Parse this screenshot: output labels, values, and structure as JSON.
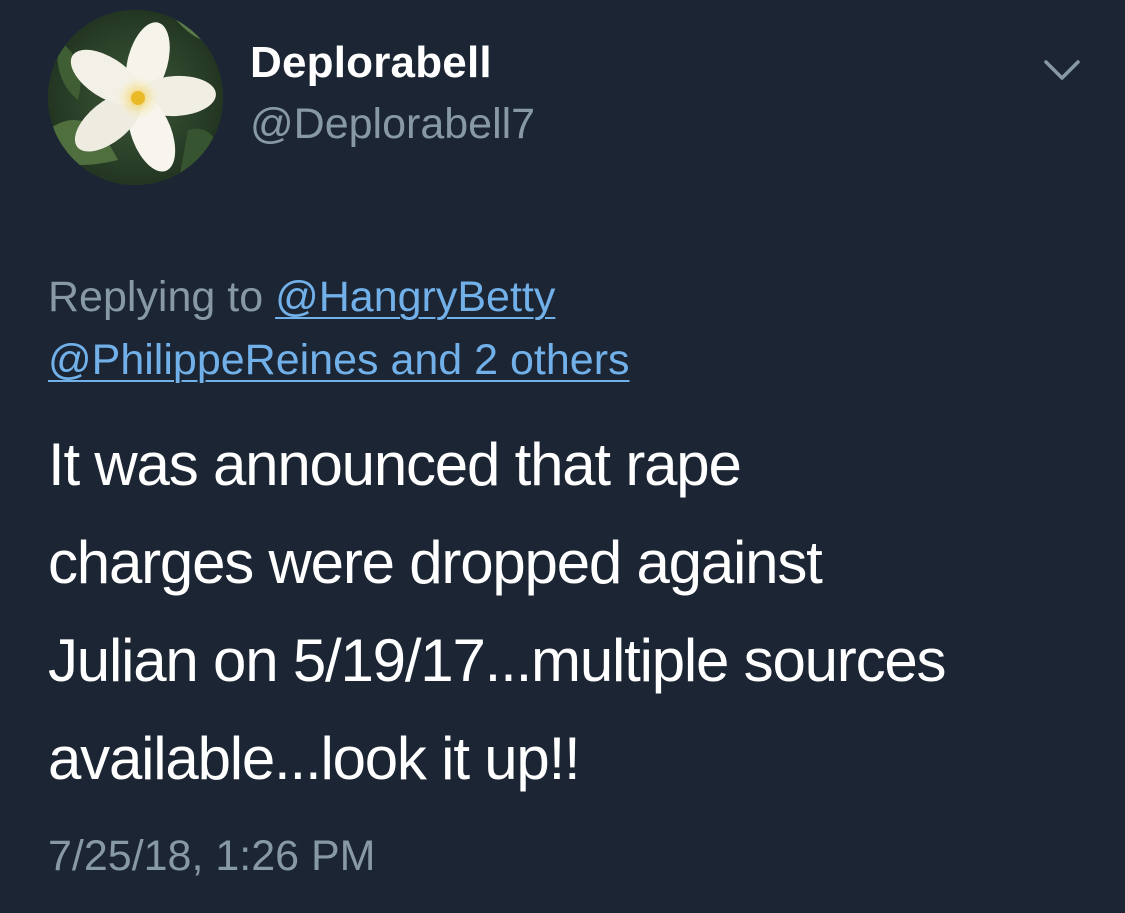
{
  "tweet": {
    "display_name": "Deplorabell",
    "handle": "@Deplorabell7",
    "avatar_icon": "plumeria-flower-avatar",
    "menu_icon": "chevron-down-icon",
    "replying_prefix": "Replying to",
    "reply_mention_1": "@HangryBetty",
    "reply_mention_2": "@PhilippeReines and 2 others",
    "text": "It was announced that rape\ncharges were dropped against\nJulian on 5/19/17...multiple sources\navailable...look it up!!",
    "timestamp": "7/25/18, 1:26 PM"
  },
  "colors": {
    "background": "#1c2533",
    "primary_text": "#ffffff",
    "secondary_text": "#8899a6",
    "link": "#71b0e8"
  }
}
